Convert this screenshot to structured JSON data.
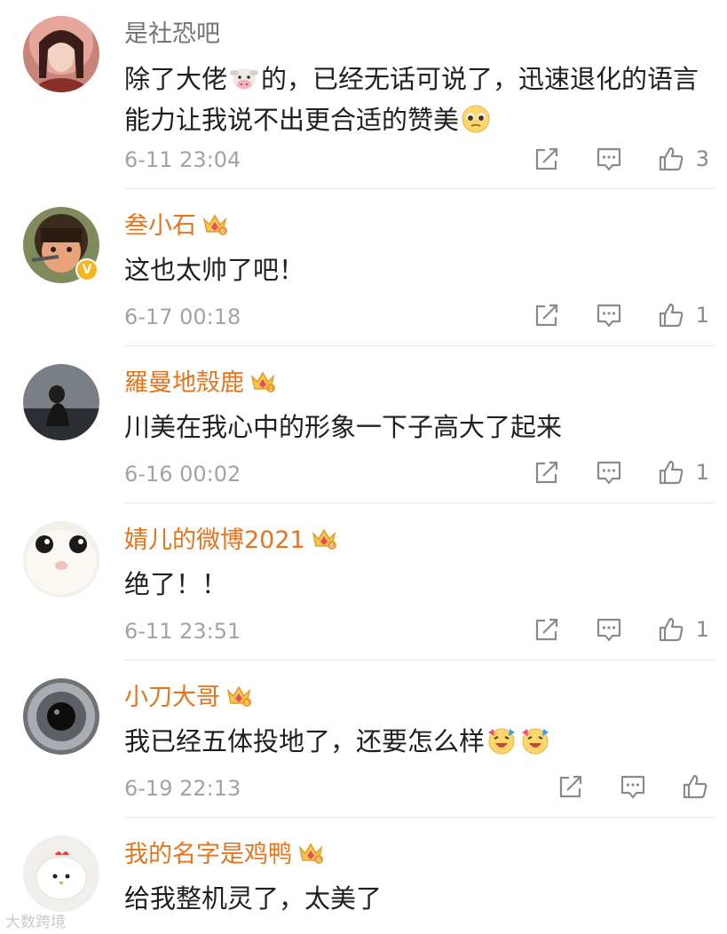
{
  "comments": [
    {
      "username": "是社恐吧",
      "text_parts": [
        "除了大佬",
        "的，已经无话可说了，迅速退化的语言能力让我说不出更合适的赞美"
      ],
      "emojis": [
        "cow-emoji",
        "pleading-face-emoji"
      ],
      "time": "6-11 23:04",
      "likes": "3",
      "verified": false,
      "crown": false
    },
    {
      "username": "叁小石",
      "text": "这也太帅了吧！",
      "time": "6-17 00:18",
      "likes": "1",
      "verified": true,
      "crown_level": "6"
    },
    {
      "username": "羅曼地殼鹿",
      "text": "川美在我心中的形象一下子高大了起来",
      "time": "6-16 00:02",
      "likes": "1",
      "crown_level": "1"
    },
    {
      "username": "婧儿的微博2021",
      "text": "绝了！！",
      "time": "6-11 23:51",
      "likes": "1",
      "crown_level": "6"
    },
    {
      "username": "小刀大哥",
      "text": "我已经五体投地了，还要怎么样",
      "emojis": [
        "cheering-face-emoji",
        "cheering-face-emoji"
      ],
      "time": "6-19 22:13",
      "likes": "",
      "crown_level": "6"
    },
    {
      "username": "我的名字是鸡鸭",
      "text": "给我整机灵了，太美了",
      "crown_level": "6"
    }
  ],
  "watermark": "大数跨境",
  "colors": {
    "username_orange": "#e8731a",
    "username_gray": "#737373",
    "meta_gray": "#a3a3a3",
    "icon_gray": "#8a8a8a",
    "divider": "#e6e6e6"
  },
  "icons": {
    "share": "share-icon",
    "reply": "comment-icon",
    "like": "thumbs-up-icon",
    "vip": "crown-badge-icon",
    "verified": "verified-v-icon"
  }
}
